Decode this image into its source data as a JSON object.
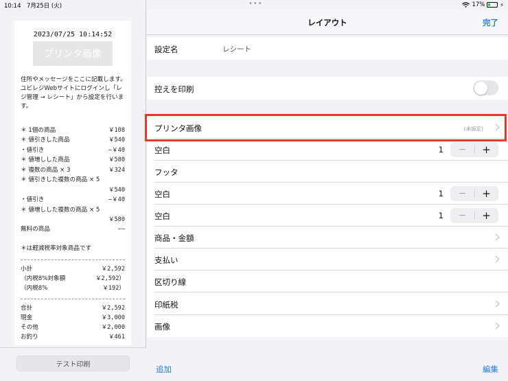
{
  "status": {
    "time_date": "10:14　7月25日 (火)",
    "battery": "17%",
    "wifi_icon": "wifi-icon",
    "dots": "•••"
  },
  "receipt": {
    "datetime": "2023/07/25 10:14:52",
    "printer_image_label": "プリンタ画像",
    "message": "住所やメッセージをここに記載します。 ユビレジWebサイトにログインし「レジ管理 → レシート」から設定を行います。",
    "items": [
      {
        "name": "＊ 1個の商品",
        "value": "￥108"
      },
      {
        "name": "＊ 値引きした商品",
        "value": "￥540"
      },
      {
        "name": "・値引き",
        "value": "−￥40"
      },
      {
        "name": "＊ 値増しした商品",
        "value": "￥580"
      },
      {
        "name": "＊ 複数の商品 × 3",
        "value": "￥324"
      },
      {
        "name": "＊ 値引きした複数の商品 × 5",
        "value": ""
      },
      {
        "name": "",
        "value": "￥540"
      },
      {
        "name": "・値引き",
        "value": "−￥40"
      },
      {
        "name": "＊ 値増しした複数の商品 × 5",
        "value": ""
      },
      {
        "name": "",
        "value": "￥580"
      },
      {
        "name": "無料の商品",
        "value": "−−"
      }
    ],
    "tax_note": "＊は軽減税率対象商品です",
    "subtotals": [
      {
        "name": "小計",
        "value": "￥2,592"
      },
      {
        "name": "（内税8%対象額",
        "value": "￥2,592）"
      },
      {
        "name": "（内税8%",
        "value": "￥192）"
      }
    ],
    "totals": [
      {
        "name": "合計",
        "value": "￥2,592"
      },
      {
        "name": "現金",
        "value": "￥3,000"
      },
      {
        "name": "その他",
        "value": "￥2,000"
      },
      {
        "name": "お釣り",
        "value": "￥461"
      }
    ],
    "test_print_label": "テスト印刷"
  },
  "nav": {
    "title": "レイアウト",
    "done": "完了"
  },
  "settings": {
    "name_label": "設定名",
    "name_value": "レシート",
    "copy_print_label": "控えを印刷",
    "copy_print_on": false,
    "rows": [
      {
        "label": "プリンタ画像",
        "detail": "(未設定)",
        "type": "chevron"
      },
      {
        "label": "空白",
        "value": "1",
        "type": "stepper"
      },
      {
        "label": "フッタ",
        "type": "plain"
      },
      {
        "label": "空白",
        "value": "1",
        "type": "stepper"
      },
      {
        "label": "空白",
        "value": "1",
        "type": "stepper"
      },
      {
        "label": "商品・金額",
        "type": "chevron"
      },
      {
        "label": "支払い",
        "type": "chevron"
      },
      {
        "label": "区切り線",
        "type": "plain"
      },
      {
        "label": "印紙税",
        "type": "chevron"
      },
      {
        "label": "画像",
        "type": "chevron"
      }
    ]
  },
  "bottom": {
    "add": "追加",
    "edit": "編集"
  },
  "colors": {
    "accent": "#2b7be0",
    "highlight": "#e53a24"
  }
}
